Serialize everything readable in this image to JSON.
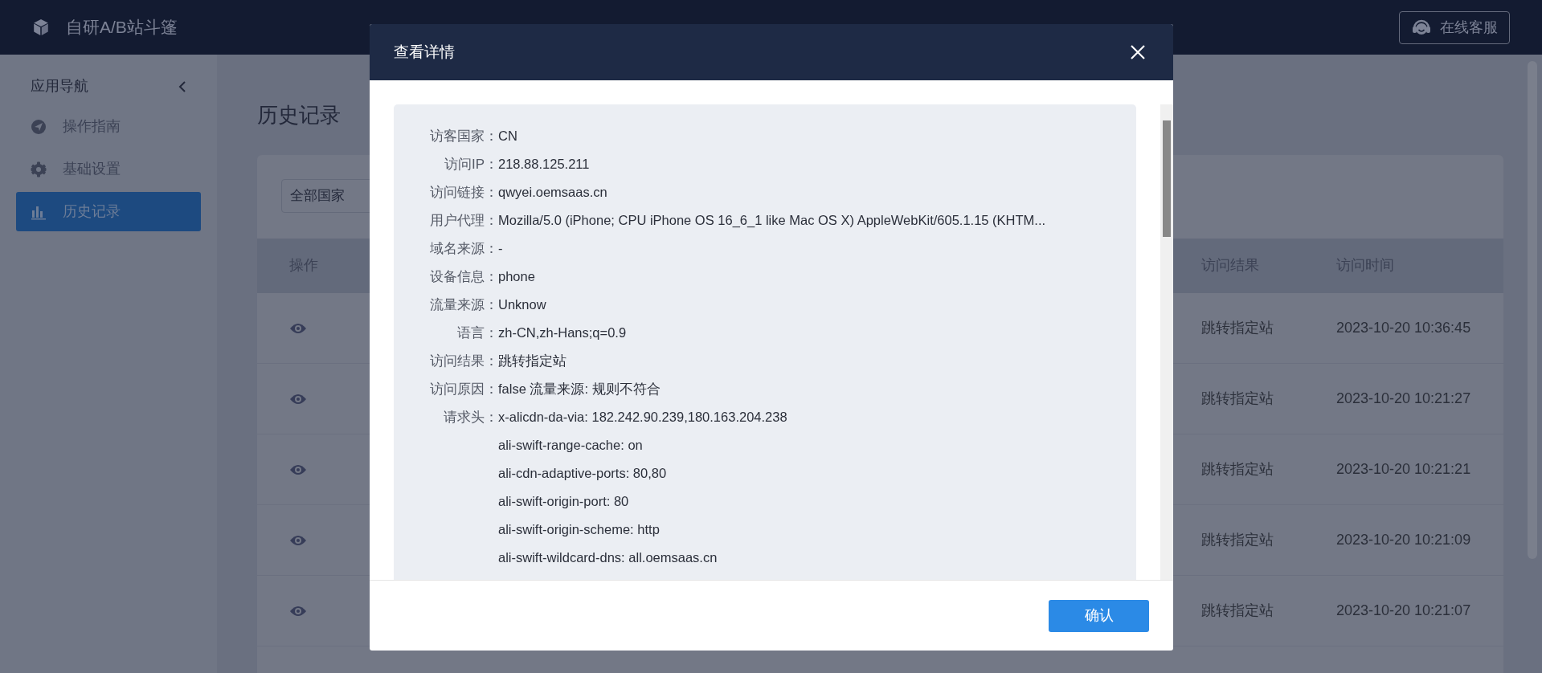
{
  "app": {
    "title": "自研A/B站斗篷",
    "support_button": "在线客服"
  },
  "sidebar": {
    "title": "应用导航",
    "items": [
      {
        "label": "操作指南",
        "kind": "guide",
        "selected": false
      },
      {
        "label": "基础设置",
        "kind": "settings",
        "selected": false
      },
      {
        "label": "历史记录",
        "kind": "history",
        "selected": true
      }
    ]
  },
  "page": {
    "title": "历史记录",
    "filter": {
      "value": "全部国家"
    },
    "table": {
      "columns": [
        "操作",
        "访问结果",
        "访问时间"
      ],
      "rows": [
        {
          "result": "跳转指定站",
          "time": "2023-10-20 10:36:45"
        },
        {
          "result": "跳转指定站",
          "time": "2023-10-20 10:21:27"
        },
        {
          "result": "跳转指定站",
          "time": "2023-10-20 10:21:21"
        },
        {
          "result": "跳转指定站",
          "time": "2023-10-20 10:21:09"
        },
        {
          "result": "跳转指定站",
          "time": "2023-10-20 10:21:07"
        }
      ]
    }
  },
  "dialog": {
    "title": "查看详情",
    "fields": [
      {
        "label": "访客国家：",
        "values": [
          "CN"
        ]
      },
      {
        "label": "访问IP：",
        "values": [
          "218.88.125.211"
        ]
      },
      {
        "label": "访问链接：",
        "values": [
          "qwyei.oemsaas.cn"
        ]
      },
      {
        "label": "用户代理：",
        "values": [
          "Mozilla/5.0 (iPhone; CPU iPhone OS 16_6_1 like Mac OS X) AppleWebKit/605.1.15 (KHTM..."
        ]
      },
      {
        "label": "域名来源：",
        "values": [
          "-"
        ]
      },
      {
        "label": "设备信息：",
        "values": [
          "phone"
        ]
      },
      {
        "label": "流量来源：",
        "values": [
          "Unknow"
        ]
      },
      {
        "label": "语言：",
        "values": [
          "zh-CN,zh-Hans;q=0.9"
        ]
      },
      {
        "label": "访问结果：",
        "values": [
          "跳转指定站"
        ]
      },
      {
        "label": "访问原因：",
        "values": [
          "false 流量来源: 规则不符合"
        ]
      },
      {
        "label": "请求头：",
        "values": [
          "x-alicdn-da-via: 182.242.90.239,180.163.204.238",
          "ali-swift-range-cache: on",
          "ali-cdn-adaptive-ports: 80,80",
          "ali-swift-origin-port: 80",
          "ali-swift-origin-scheme: http",
          "ali-swift-wildcard-dns: all.oemsaas.cn"
        ]
      }
    ],
    "confirm_button": "确认"
  }
}
